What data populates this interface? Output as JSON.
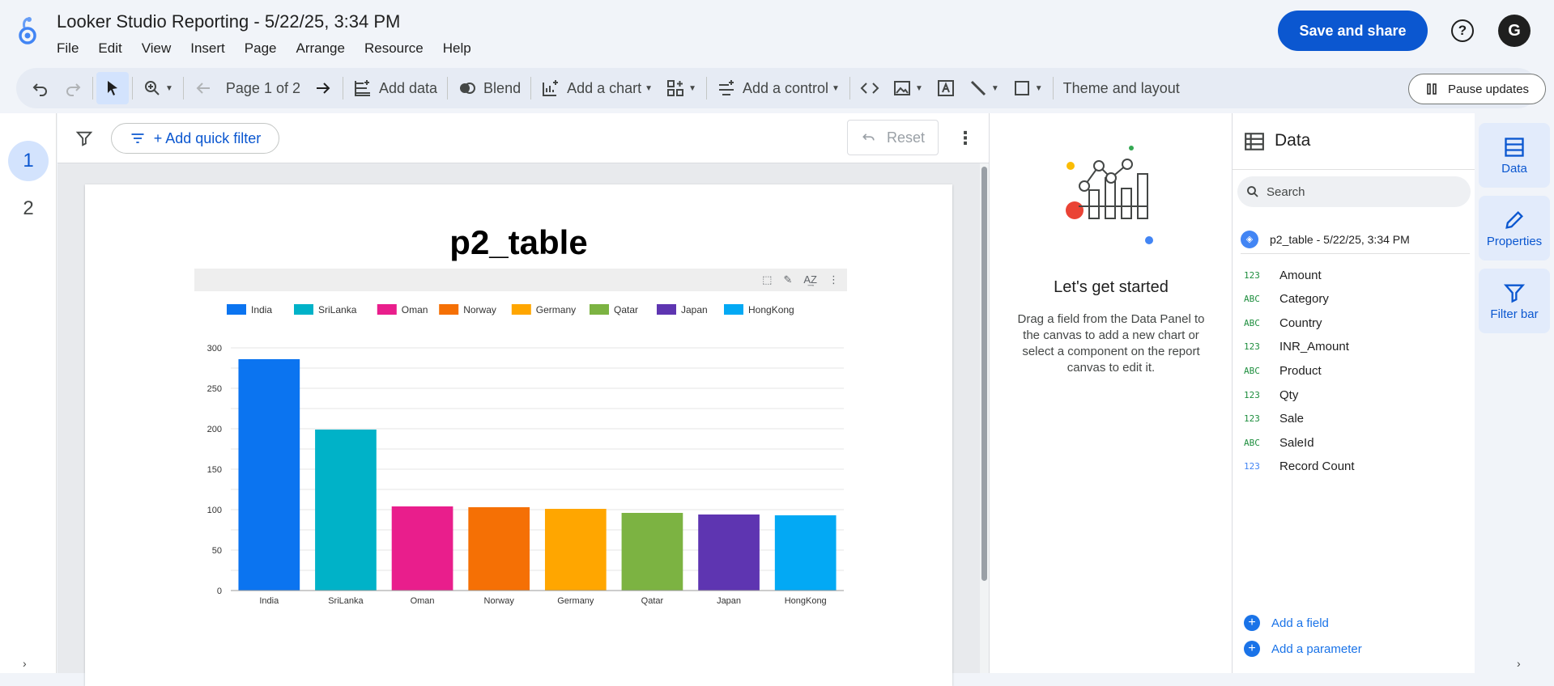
{
  "app": {
    "title": "Looker Studio Reporting - 5/22/25, 3:34 PM",
    "menu": [
      "File",
      "Edit",
      "View",
      "Insert",
      "Page",
      "Arrange",
      "Resource",
      "Help"
    ],
    "save_label": "Save and share",
    "help_label": "?",
    "avatar_label": "G"
  },
  "toolbar": {
    "page_label": "Page 1 of 2",
    "add_data": "Add data",
    "blend": "Blend",
    "add_chart": "Add a chart",
    "add_control": "Add a control",
    "theme_layout": "Theme and layout",
    "pause_updates": "Pause updates"
  },
  "filterbar": {
    "quick_filter": "+ Add quick filter",
    "reset": "Reset"
  },
  "pages": [
    "1",
    "2"
  ],
  "report": {
    "title": "p2_table"
  },
  "chart_data": {
    "type": "bar",
    "categories": [
      "India",
      "SriLanka",
      "Oman",
      "Norway",
      "Germany",
      "Qatar",
      "Japan",
      "HongKong"
    ],
    "values": [
      286,
      199,
      104,
      103,
      101,
      96,
      94,
      93
    ],
    "colors": [
      "#0b74f0",
      "#00b2c8",
      "#e91e8c",
      "#f57005",
      "#ffa600",
      "#7cb342",
      "#5e35b1",
      "#03a9f4"
    ],
    "legend": [
      "India",
      "SriLanka",
      "Oman",
      "Norway",
      "Germany",
      "Qatar",
      "Japan",
      "HongKong"
    ],
    "yticks": [
      0,
      50,
      100,
      150,
      200,
      250,
      300
    ],
    "ylim": [
      0,
      300
    ],
    "legend_position": "top"
  },
  "getting_started": {
    "title": "Let's get started",
    "description": "Drag a field from the Data Panel to the canvas to add a new chart or select a component on the report canvas to edit it."
  },
  "data_panel": {
    "title": "Data",
    "search_placeholder": "Search",
    "source": "p2_table - 5/22/25, 3:34 PM",
    "fields": [
      {
        "type": "123",
        "name": "Amount"
      },
      {
        "type": "ABC",
        "name": "Category"
      },
      {
        "type": "ABC",
        "name": "Country"
      },
      {
        "type": "123",
        "name": "INR_Amount"
      },
      {
        "type": "ABC",
        "name": "Product"
      },
      {
        "type": "123",
        "name": "Qty"
      },
      {
        "type": "123",
        "name": "Sale"
      },
      {
        "type": "ABC",
        "name": "SaleId"
      },
      {
        "type": "123",
        "name": "Record Count"
      }
    ],
    "add_field": "Add a field",
    "add_parameter": "Add a parameter"
  },
  "side_tabs": [
    "Data",
    "Properties",
    "Filter bar"
  ]
}
